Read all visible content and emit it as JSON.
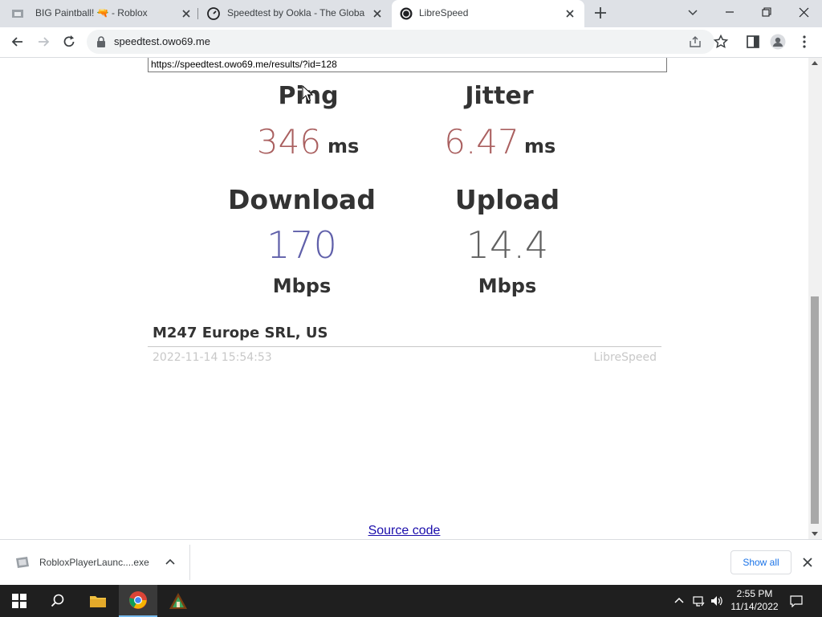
{
  "browser": {
    "tabs": [
      {
        "title": "BIG Paintball! 🔫 - Roblox",
        "icon": "roblox-page-icon",
        "active": false
      },
      {
        "title": "Speedtest by Ookla - The Global",
        "icon": "ookla-icon",
        "active": false
      },
      {
        "title": "LibreSpeed",
        "icon": "librespeed-icon",
        "active": true
      }
    ],
    "address": "speedtest.owo69.me"
  },
  "page": {
    "share_url": "https://speedtest.owo69.me/results/?id=128",
    "ping": {
      "label": "Ping",
      "value": "346",
      "unit": "ms"
    },
    "jitter": {
      "label": "Jitter",
      "value": "6.47",
      "unit": "ms"
    },
    "download": {
      "label": "Download",
      "value": "170",
      "unit": "Mbps"
    },
    "upload": {
      "label": "Upload",
      "value": "14.4",
      "unit": "Mbps"
    },
    "isp": "M247 Europe SRL, US",
    "timestamp": "2022-11-14 15:54:53",
    "brand": "LibreSpeed",
    "source_link": "Source code",
    "colors": {
      "ping": "#aa6060",
      "download": "#6060aa",
      "upload": "#616161",
      "title": "#333333"
    }
  },
  "downloads": {
    "file_name": "RobloxPlayerLaunc....exe",
    "show_all": "Show all"
  },
  "taskbar": {
    "time": "2:55 PM",
    "date": "11/14/2022"
  }
}
